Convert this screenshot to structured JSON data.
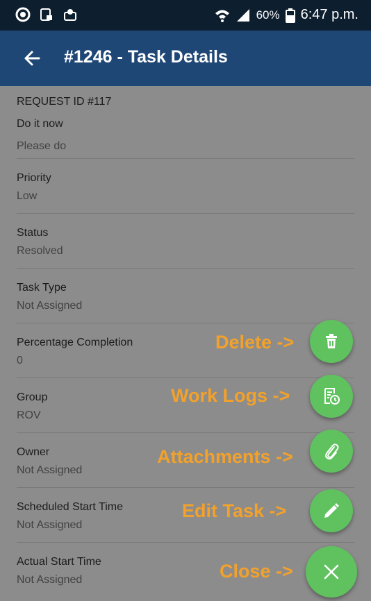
{
  "status_bar": {
    "battery": "60%",
    "time": "6:47 p.m."
  },
  "app_bar": {
    "title": "#1246 - Task Details"
  },
  "request": {
    "id_label": "REQUEST ID #117",
    "name": "Do it now",
    "description": "Please do"
  },
  "fields": [
    {
      "label": "Priority",
      "value": "Low"
    },
    {
      "label": "Status",
      "value": "Resolved"
    },
    {
      "label": "Task Type",
      "value": "Not Assigned"
    },
    {
      "label": "Percentage Completion",
      "value": "0"
    },
    {
      "label": "Group",
      "value": "ROV"
    },
    {
      "label": "Owner",
      "value": "Not Assigned"
    },
    {
      "label": "Scheduled Start Time",
      "value": "Not Assigned"
    },
    {
      "label": "Actual Start Time",
      "value": "Not Assigned"
    }
  ],
  "actions": {
    "delete": "Delete ->",
    "work_logs": "Work Logs ->",
    "attachments": "Attachments ->",
    "edit_task": "Edit Task ->",
    "close": "Close ->"
  },
  "colors": {
    "app_bar": "#1f4776",
    "status_bar": "#0d1e2f",
    "fab": "#5fc25f",
    "annotation": "#f2a12b"
  },
  "icons": {
    "back": "arrow-left-icon",
    "delete": "trash-icon",
    "work_logs": "log-clock-icon",
    "attachments": "paperclip-icon",
    "edit": "pencil-icon",
    "close": "close-icon"
  }
}
